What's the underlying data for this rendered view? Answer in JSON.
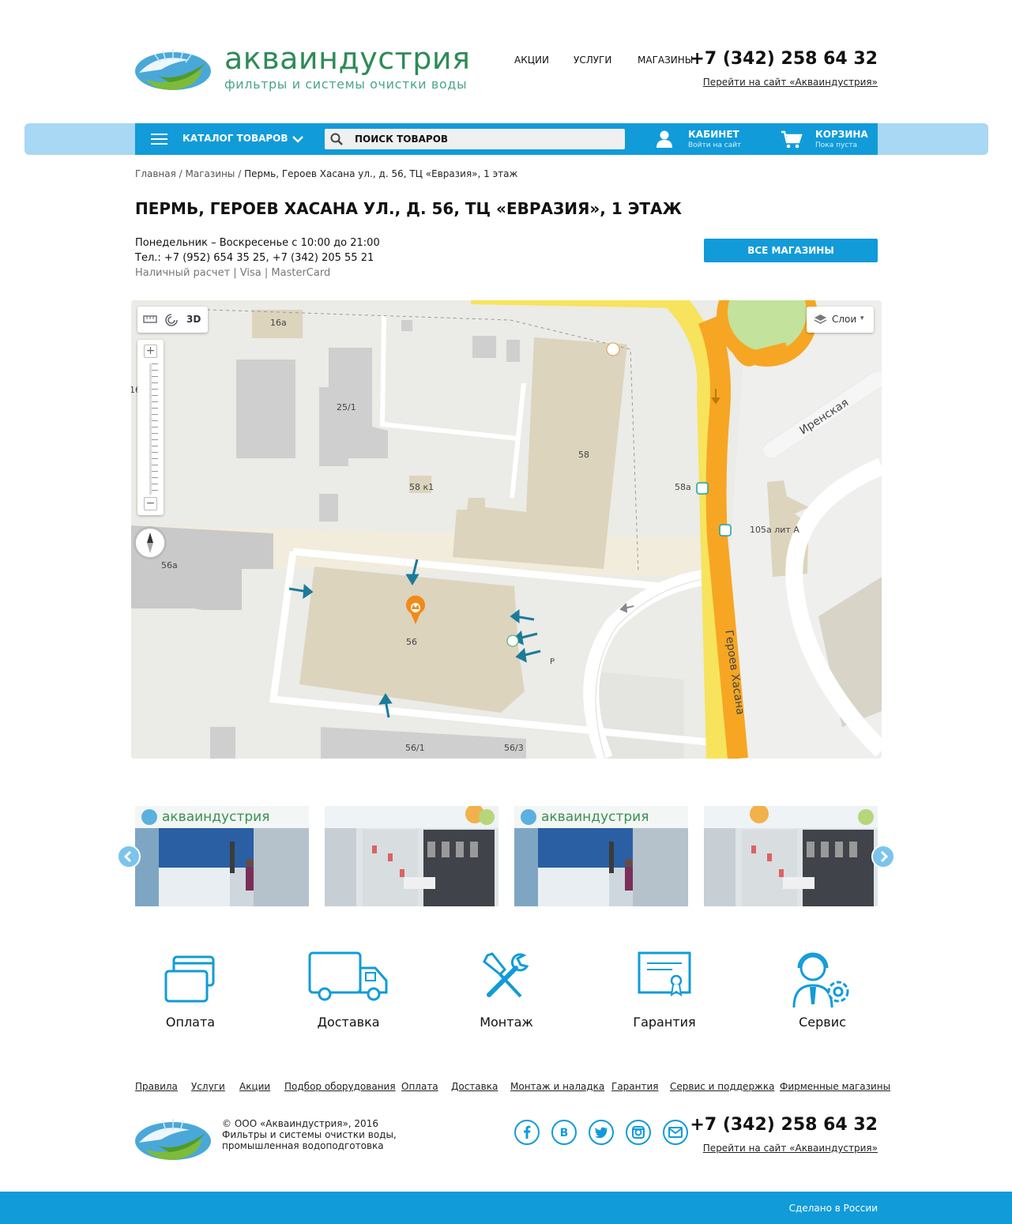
{
  "header": {
    "brand_name": "акваиндустрия",
    "brand_tagline": "фильтры и системы очистки воды",
    "nav": [
      "АКЦИИ",
      "УСЛУГИ",
      "МАГАЗИНЫ"
    ],
    "phone": "+7 (342) 258 64 32",
    "site_link": "Перейти на сайт «Акваиндустрия»"
  },
  "toolbar": {
    "catalog_label": "КАТАЛОГ ТОВАРОВ",
    "search_placeholder": "ПОИСК ТОВАРОВ",
    "cabinet_title": "КАБИНЕТ",
    "cabinet_sub": "Войти на сайт",
    "cart_title": "КОРЗИНА",
    "cart_sub": "Пока пуста"
  },
  "breadcrumb": {
    "items": [
      "Главная",
      "Магазины"
    ],
    "current": "Пермь, Героев Хасана ул., д. 56, ТЦ «Евразия», 1 этаж"
  },
  "store": {
    "title": "ПЕРМЬ, ГЕРОЕВ ХАСАНА УЛ., Д. 56, ТЦ «ЕВРАЗИЯ», 1 ЭТАЖ",
    "hours": "Понедельник – Воскресенье с 10:00 до 21:00",
    "phones": "Тел.: +7 (952) 654 35 25, +7 (342) 205 55 21",
    "payments": "Наличный расчет | Visa | MasterCard",
    "all_stores_label": "ВСЕ МАГАЗИНЫ"
  },
  "map": {
    "btn_3d": "3D",
    "layers_label": "Слои",
    "labels": {
      "b16a": "16а",
      "b25_1": "25/1",
      "b58": "58",
      "b58k1": "58 к1",
      "b58a": "58а",
      "b105a": "105а лит А",
      "b56a": "56а",
      "b56": "56",
      "b56_1": "56/1",
      "b56_3": "56/3",
      "b16": "16",
      "parking": "P",
      "street_irenskaya": "Иренская",
      "street_geroev": "Героев Хасана"
    }
  },
  "gallery": {
    "sign_text": "акваиндустрия",
    "sign_small": "фильтры и системы очистки воды"
  },
  "services": [
    "Оплата",
    "Доставка",
    "Монтаж",
    "Гарантия",
    "Сервис"
  ],
  "footer": {
    "nav": [
      "Правила",
      "Услуги",
      "Акции",
      "Подбор оборудования",
      "Оплата",
      "Доставка",
      "Монтаж и наладка",
      "Гарантия",
      "Сервис и поддержка",
      "Фирменные магазины"
    ],
    "copyright": "© ООО «Акваиндустрия», 2016",
    "desc_1": "Фильтры и системы очистки воды,",
    "desc_2": "промышленная водоподготовка",
    "social": [
      "facebook-icon",
      "vk-icon",
      "twitter-icon",
      "instagram-icon",
      "mail-icon"
    ],
    "phone": "+7 (342) 258 64 32",
    "site_link": "Перейти на сайт «Акваиндустрия»",
    "made_in": "Сделано в России"
  },
  "colors": {
    "accent": "#119bd9",
    "accent_light": "#a8d8f3",
    "brand_green": "#2e8b57",
    "road_orange": "#f6a623",
    "road_yellow": "#f7e35c"
  }
}
